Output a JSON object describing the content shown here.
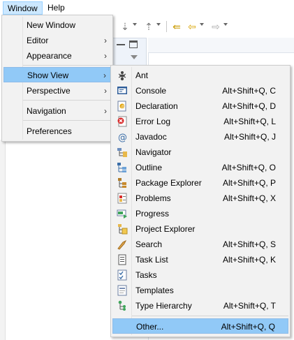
{
  "menubar": {
    "window": "Window",
    "help": "Help"
  },
  "window_menu": {
    "items": [
      {
        "label": "New Window",
        "submenu": false
      },
      {
        "label": "Editor",
        "submenu": true
      },
      {
        "label": "Appearance",
        "submenu": true
      },
      {
        "label": "Show View",
        "submenu": true,
        "highlighted": true
      },
      {
        "label": "Perspective",
        "submenu": true
      },
      {
        "label": "Navigation",
        "submenu": true
      },
      {
        "label": "Preferences",
        "submenu": false
      }
    ],
    "submenu_glyph": "›"
  },
  "show_view_menu": {
    "items": [
      {
        "label": "Ant",
        "accel": "",
        "icon": "ant-icon"
      },
      {
        "label": "Console",
        "accel": "Alt+Shift+Q, C",
        "icon": "console-icon"
      },
      {
        "label": "Declaration",
        "accel": "Alt+Shift+Q, D",
        "icon": "declaration-icon"
      },
      {
        "label": "Error Log",
        "accel": "Alt+Shift+Q, L",
        "icon": "error-log-icon"
      },
      {
        "label": "Javadoc",
        "accel": "Alt+Shift+Q, J",
        "icon": "javadoc-icon"
      },
      {
        "label": "Navigator",
        "accel": "",
        "icon": "navigator-icon"
      },
      {
        "label": "Outline",
        "accel": "Alt+Shift+Q, O",
        "icon": "outline-icon"
      },
      {
        "label": "Package Explorer",
        "accel": "Alt+Shift+Q, P",
        "icon": "package-explorer-icon"
      },
      {
        "label": "Problems",
        "accel": "Alt+Shift+Q, X",
        "icon": "problems-icon"
      },
      {
        "label": "Progress",
        "accel": "",
        "icon": "progress-icon"
      },
      {
        "label": "Project Explorer",
        "accel": "",
        "icon": "project-explorer-icon"
      },
      {
        "label": "Search",
        "accel": "Alt+Shift+Q, S",
        "icon": "search-icon"
      },
      {
        "label": "Task List",
        "accel": "Alt+Shift+Q, K",
        "icon": "task-list-icon"
      },
      {
        "label": "Tasks",
        "accel": "",
        "icon": "tasks-icon"
      },
      {
        "label": "Templates",
        "accel": "",
        "icon": "templates-icon"
      },
      {
        "label": "Type Hierarchy",
        "accel": "Alt+Shift+Q, T",
        "icon": "type-hierarchy-icon"
      },
      {
        "label": "Other...",
        "accel": "Alt+Shift+Q, Q",
        "icon": "",
        "highlighted": true
      }
    ]
  },
  "colors": {
    "menu_bg": "#f2f2f2",
    "highlight": "#91c9f7",
    "menubar_active": "#cce8ff"
  }
}
